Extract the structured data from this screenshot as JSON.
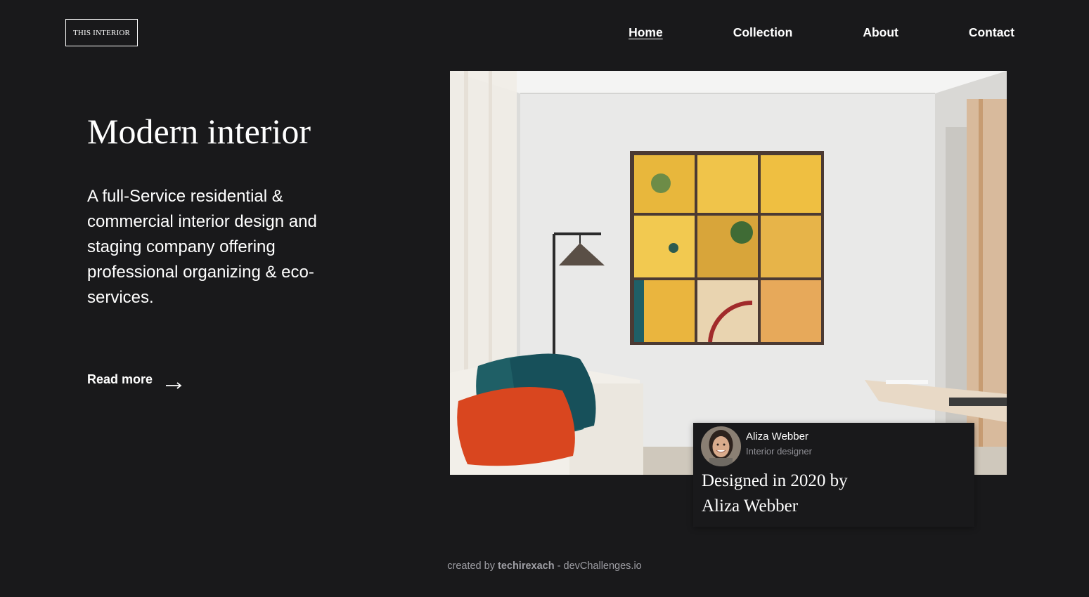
{
  "header": {
    "logo_text": "THIS INTERIOR",
    "nav": [
      {
        "label": "Home",
        "active": true
      },
      {
        "label": "Collection",
        "active": false
      },
      {
        "label": "About",
        "active": false
      },
      {
        "label": "Contact",
        "active": false
      }
    ]
  },
  "hero": {
    "title": "Modern interior",
    "description": "A full-Service residential & commercial interior design and staging company offering professional organizing & eco-services.",
    "read_more_label": "Read more",
    "read_more_icon": "arrow-right-icon"
  },
  "card": {
    "designer_name": "Aliza Webber",
    "designer_role": "Interior designer",
    "caption": "Designed in 2020 by Aliza Webber"
  },
  "footer": {
    "prefix": "created by",
    "author": "techirexach",
    "separator": "-",
    "site": "devChallenges.io"
  },
  "colors": {
    "background": "#19191b",
    "text": "#ffffff",
    "muted": "#8f8f95"
  }
}
